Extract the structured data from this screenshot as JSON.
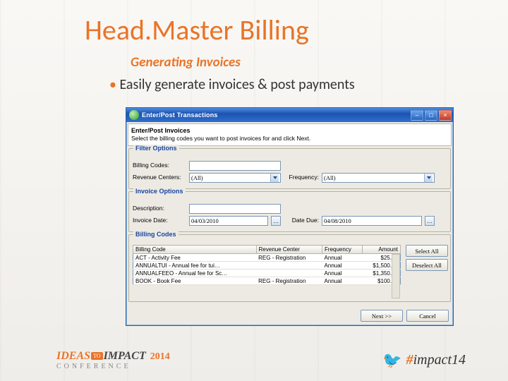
{
  "slide": {
    "title": "Head.Master Billing",
    "subtitle": "Generating Invoices",
    "bullet": "Easily generate invoices & post payments"
  },
  "footer": {
    "left_ideas": "IDEAS",
    "left_to": "TO",
    "left_impact": "IMPACT",
    "left_year": "2014",
    "left_conf": "CONFERENCE",
    "hashtag_hash": "#",
    "hashtag_text": "impact14"
  },
  "dialog": {
    "title": "Enter/Post Transactions",
    "instruction_header": "Enter/Post Invoices",
    "instruction_text": "Select the billing codes you want to post invoices for and click Next.",
    "filter": {
      "legend": "Filter Options",
      "billing_codes_label": "Billing Codes:",
      "billing_codes_value": "",
      "revenue_centers_label": "Revenue Centers:",
      "revenue_centers_value": "(All)",
      "frequency_label": "Frequency:",
      "frequency_value": "(All)"
    },
    "invoice": {
      "legend": "Invoice Options",
      "description_label": "Description:",
      "description_value": "",
      "invoice_date_label": "Invoice Date:",
      "invoice_date_value": "04/03/2010",
      "date_due_label": "Date Due:",
      "date_due_value": "04/08/2010"
    },
    "codes": {
      "legend": "Billing Codes",
      "columns": [
        "Billing Code",
        "Revenue Center",
        "Frequency",
        "Amount"
      ],
      "rows": [
        {
          "code": "ACT - Activity Fee",
          "center": "REG - Registration",
          "freq": "Annual",
          "amt": "$25.00"
        },
        {
          "code": "ANNUALTUI - Annual fee for tui…",
          "center": "",
          "freq": "Annual",
          "amt": "$1,500.00"
        },
        {
          "code": "ANNUALFEEO - Annual fee for Sc…",
          "center": "",
          "freq": "Annual",
          "amt": "$1,350.00"
        },
        {
          "code": "BOOK - Book Fee",
          "center": "REG - Registration",
          "freq": "Annual",
          "amt": "$100.00"
        }
      ],
      "select_all": "Select All",
      "deselect_all": "Deselect All"
    },
    "next": "Next >>",
    "cancel": "Cancel"
  }
}
